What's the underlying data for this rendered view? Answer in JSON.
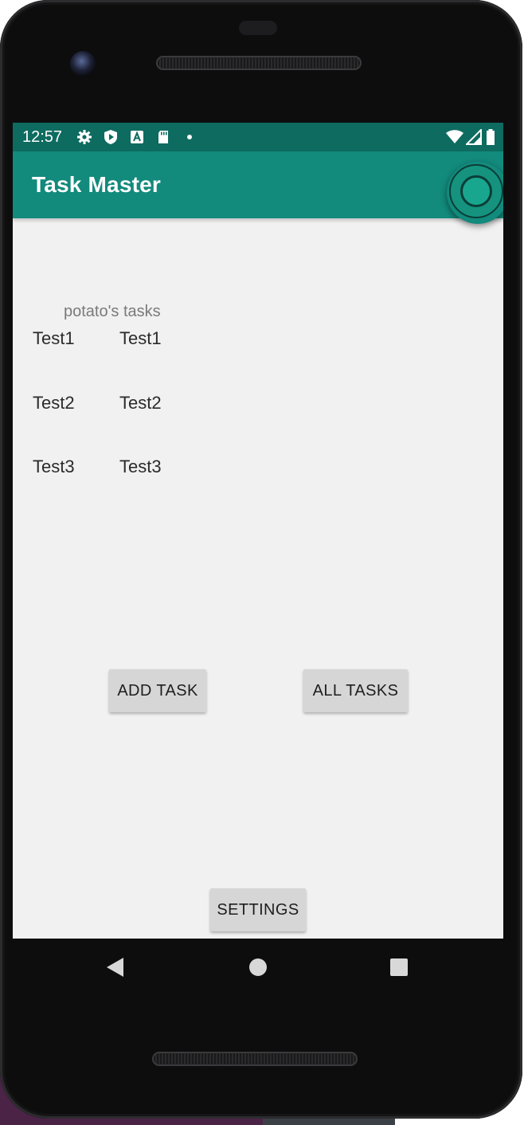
{
  "status_bar": {
    "time": "12:57",
    "icons_left": [
      "gear-icon",
      "shield-icon",
      "text-a-icon",
      "sd-card-icon",
      "dot-icon"
    ],
    "icons_right": [
      "wifi-icon",
      "cell-signal-icon",
      "battery-icon"
    ]
  },
  "app_bar": {
    "title": "Task Master",
    "action_icon": "circle-icon"
  },
  "tasks": {
    "header": "potato's tasks",
    "rows": [
      {
        "col1": "Test1",
        "col2": "Test1"
      },
      {
        "col1": "Test2",
        "col2": "Test2"
      },
      {
        "col1": "Test3",
        "col2": "Test3"
      }
    ]
  },
  "buttons": {
    "add_task": "ADD TASK",
    "all_tasks": "ALL TASKS",
    "settings": "SETTINGS"
  },
  "nav": {
    "back": "back-icon",
    "home": "home-icon",
    "recents": "recents-icon"
  },
  "colors": {
    "status_bar": "#0e6b60",
    "app_bar": "#128a7c",
    "screen_bg": "#f1f1f1",
    "button_bg": "#d6d6d6"
  }
}
